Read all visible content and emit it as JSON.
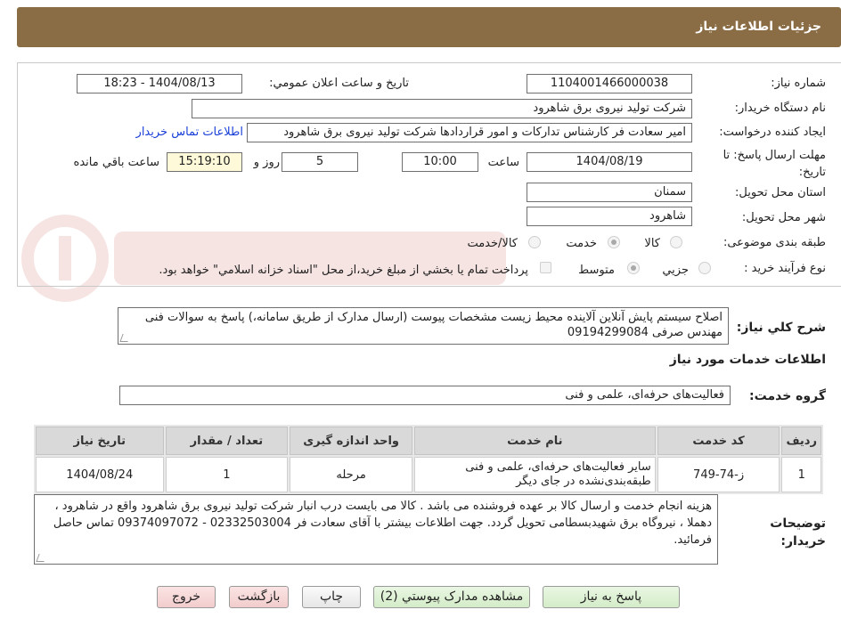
{
  "header": {
    "title": "جزئیات اطلاعات نیاز"
  },
  "fields": {
    "need_number_label": "شماره نیاز:",
    "need_number": "1104001466000038",
    "announce_label": "تاریخ و ساعت اعلان عمومي:",
    "announce_value": "1404/08/13 - 18:23",
    "buyer_org_label": "نام دستگاه خريدار:",
    "buyer_org": "شرکت تولید نیروی برق شاهرود",
    "requester_label": "ايجاد کننده درخواست:",
    "requester": "امیر سعادت فر کارشناس تدارکات و امور قراردادها شرکت تولید نیروی برق شاهرود",
    "contact_link": "اطلاعات تماس خريدار",
    "deadline_label": "مهلت ارسال پاسخ: تا تاریخ:",
    "deadline_date": "1404/08/19",
    "time_label": "ساعت",
    "deadline_time": "10:00",
    "days_value": "5",
    "days_label": "روز و",
    "remaining_time": "15:19:10",
    "remaining_label": "ساعت باقي مانده",
    "province_label": "استان محل تحويل:",
    "province": "سمنان",
    "city_label": "شهر محل تحويل:",
    "city": "شاهرود",
    "category_label": "طبقه بندی موضوعی:",
    "category_options": [
      "کالا",
      "خدمت",
      "کالا/خدمت"
    ],
    "category_selected": "خدمت",
    "process_label": "نوع فرآيند خريد :",
    "process_options": [
      "جزيي",
      "متوسط"
    ],
    "process_selected": "متوسط",
    "payment_note": "پرداخت تمام يا بخشي از مبلغ خريد،از محل \"اسناد خزانه اسلامي\" خواهد بود."
  },
  "description": {
    "label": "شرح کلي نياز:",
    "text": "اصلاح سیستم پایش آنلاین آلاینده محیط زیست مشخصات پیوست (ارسال مدارک از طریق سامانه،) پاسخ به سوالات فنی مهندس صرفی 09194299084"
  },
  "services": {
    "section_title": "اطلاعات خدمات مورد نياز",
    "group_label": "گروه خدمت:",
    "group_value": "فعالیت‌های حرفه‌ای، علمی و فنی",
    "columns": [
      "رديف",
      "کد خدمت",
      "نام خدمت",
      "واحد اندازه گيری",
      "تعداد / مقدار",
      "تاريخ نياز"
    ],
    "rows": [
      [
        "1",
        "ز-74-749",
        "سایر فعالیت‌های حرفه‌ای، علمی و فنی طبقه‌بندی‌نشده در جای دیگر",
        "مرحله",
        "1",
        "1404/08/24"
      ]
    ]
  },
  "buyer_notes": {
    "label": "توضيحات خريدار:",
    "text": "هزینه انجام خدمت و ارسال کالا بر عهده فروشنده می باشد . کالا می بایست درب انبار شرکت تولید نیروی برق شاهرود واقع در شاهرود ، دهملا ، نیروگاه برق شهیدبسطامی تحویل گردد. جهت اطلاعات بیشتر با آقای سعادت فر 02332503004 - 09374097072 تماس حاصل فرمائید."
  },
  "buttons": {
    "reply": "پاسخ به نياز",
    "attachments": "مشاهده مدارک پيوستي (2)",
    "print": "چاپ",
    "back": "بازگشت",
    "exit": "خروج"
  },
  "colors": {
    "header_bg": "#8b6d45",
    "link": "#1a40d8",
    "remaining_bg": "#fdf9d9"
  },
  "icons": {
    "watermark": "ariatender-logo-watermark"
  }
}
